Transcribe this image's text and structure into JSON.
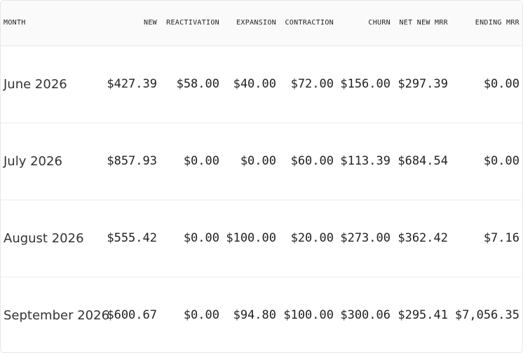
{
  "table": {
    "headers": [
      "MONTH",
      "NEW",
      "REACTIVATION",
      "EXPANSION",
      "CONTRACTION",
      "CHURN",
      "NET NEW MRR",
      "ENDING MRR"
    ],
    "rows": [
      [
        "June 2026",
        "$427.39",
        "$58.00",
        "$40.00",
        "$72.00",
        "$156.00",
        "$297.39",
        "$0.00"
      ],
      [
        "July 2026",
        "$857.93",
        "$0.00",
        "$0.00",
        "$60.00",
        "$113.39",
        "$684.54",
        "$0.00"
      ],
      [
        "August 2026",
        "$555.42",
        "$0.00",
        "$100.00",
        "$20.00",
        "$273.00",
        "$362.42",
        "$7.16"
      ],
      [
        "September 2026",
        "$600.67",
        "$0.00",
        "$94.80",
        "$100.00",
        "$300.06",
        "$295.41",
        "$7,056.35"
      ]
    ]
  }
}
